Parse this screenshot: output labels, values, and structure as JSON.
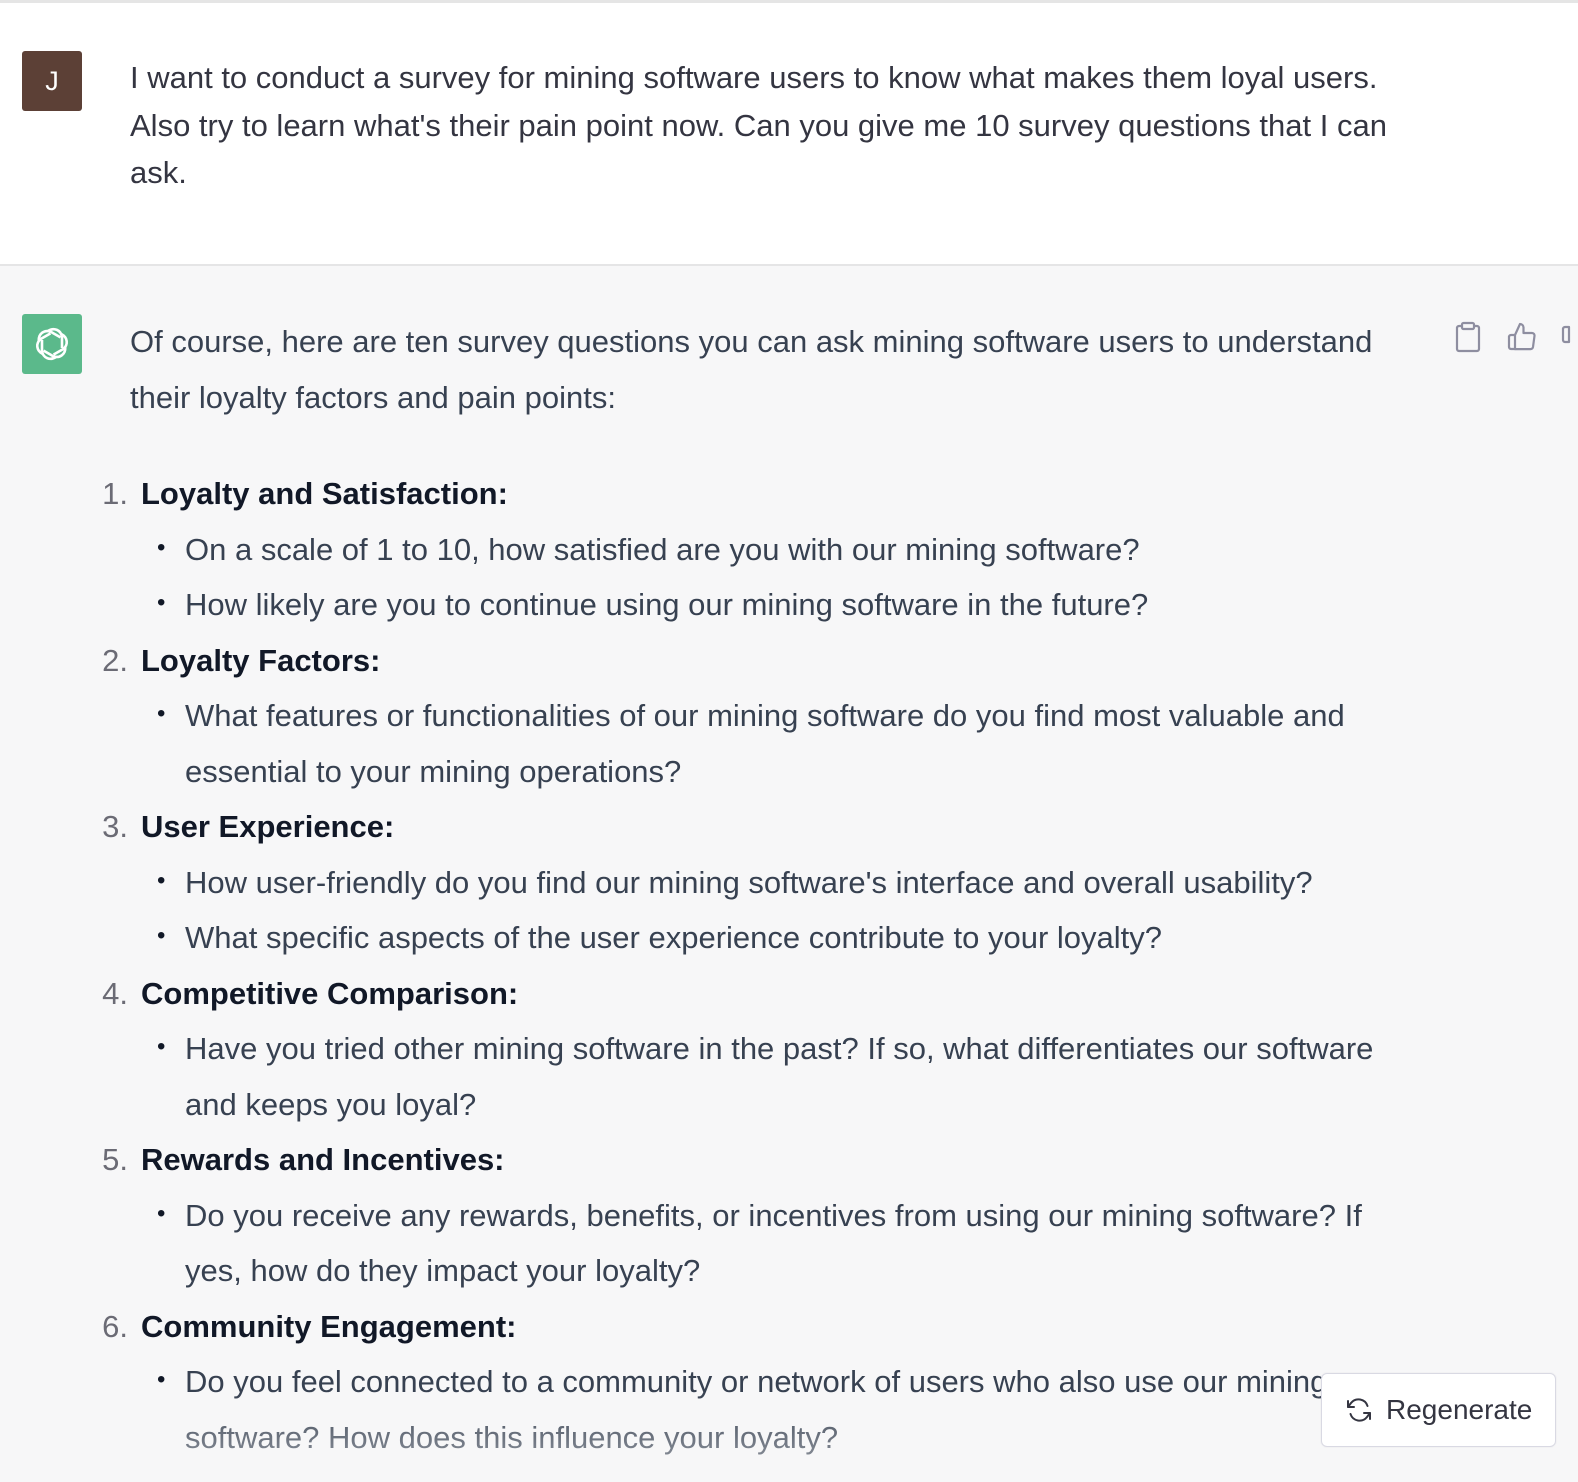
{
  "user_message": {
    "avatar_letter": "J",
    "avatar_color": "#5c4036",
    "text": "I want to conduct a survey for mining software users to know what makes them loyal users. Also try to learn what's their pain point now. Can you give me 10 survey questions that I can ask."
  },
  "assistant_message": {
    "avatar_icon": "openai-logo-icon",
    "avatar_color": "#5bb98b",
    "intro": "Of course, here are ten survey questions you can ask mining software users to understand their loyalty factors and pain points:",
    "items": [
      {
        "number": "1.",
        "title": "Loyalty and Satisfaction:",
        "bullets": [
          "On a scale of 1 to 10, how satisfied are you with our mining software?",
          "How likely are you to continue using our mining software in the future?"
        ]
      },
      {
        "number": "2.",
        "title": "Loyalty Factors:",
        "bullets": [
          "What features or functionalities of our mining software do you find most valuable and essential to your mining operations?"
        ]
      },
      {
        "number": "3.",
        "title": "User Experience:",
        "bullets": [
          "How user-friendly do you find our mining software's interface and overall usability?",
          "What specific aspects of the user experience contribute to your loyalty?"
        ]
      },
      {
        "number": "4.",
        "title": "Competitive Comparison:",
        "bullets": [
          "Have you tried other mining software in the past? If so, what differentiates our software and keeps you loyal?"
        ]
      },
      {
        "number": "5.",
        "title": "Rewards and Incentives:",
        "bullets": [
          "Do you receive any rewards, benefits, or incentives from using our mining software? If yes, how do they impact your loyalty?"
        ]
      },
      {
        "number": "6.",
        "title": "Community Engagement:",
        "bullets": [
          "Do you feel connected to a community or network of users who also use our mining software? How does this influence your loyalty?"
        ]
      }
    ]
  },
  "actions": {
    "copy_icon": "clipboard-icon",
    "thumbs_up_icon": "thumbs-up-icon",
    "thumbs_down_icon": "thumbs-down-icon"
  },
  "regenerate": {
    "label": "Regenerate",
    "icon": "refresh-icon"
  }
}
